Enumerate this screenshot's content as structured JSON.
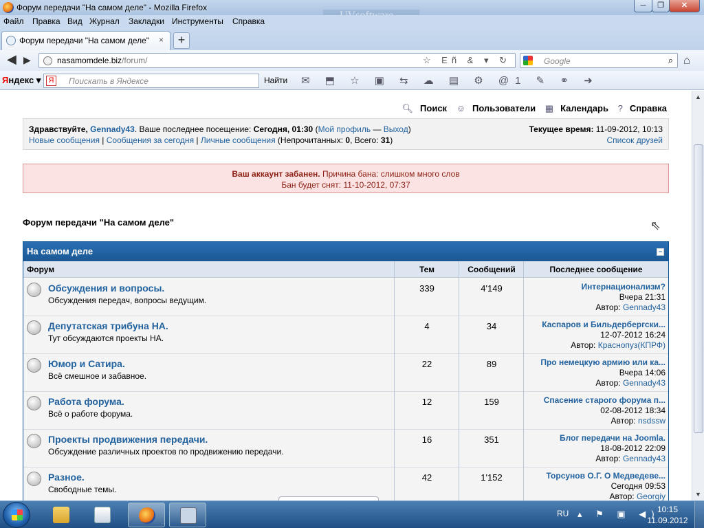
{
  "window": {
    "title": "Форум передачи \"На самом деле\" - Mozilla Firefox",
    "min": "─",
    "max": "❐",
    "close": "✕",
    "bg_text": "UVsoftware"
  },
  "menu": [
    "Файл",
    "Правка",
    "Вид",
    "Журнал",
    "Закладки",
    "Инструменты",
    "Справка"
  ],
  "tab": {
    "label": "Форум передачи \"На самом деле\"",
    "close": "×",
    "new": "+"
  },
  "nav": {
    "back": "◀",
    "forward": "▶",
    "url_host": "nasamomdele.biz",
    "url_path": "/forum/",
    "url_icons": "☆ Eñ & ▾ ↻",
    "search_placeholder": "Google",
    "search_icon": "⌕",
    "home": "⌂"
  },
  "yandex": {
    "logo_first": "Я",
    "logo_rest": "ндекс",
    "logo_arrow": "▾",
    "ya_badge": "Я",
    "placeholder": "Поискать в Яндексе",
    "find": "Найти",
    "toolbar_icons": "✉ ⬒ ☆ ▣ ⇆ ☁ ▤ ⚙ @1 ✎ ⚭ ➜"
  },
  "toplinks": {
    "search": "Поиск",
    "users": "Пользователи",
    "calendar": "Календарь",
    "help": "Справка"
  },
  "welcome": {
    "greeting": "Здравствуйте,",
    "username": "Gennady43",
    "last_visit_label": ". Ваше последнее посещение:",
    "last_visit": "Сегодня, 01:30",
    "profile": "Мой профиль",
    "dash": "—",
    "logout": "Выход",
    "new_posts": "Новые сообщения",
    "today_posts": "Сообщения за сегодня",
    "pm": "Личные сообщения",
    "unread_label": "(Непрочитанных:",
    "unread": "0",
    "total_label": ", Всего:",
    "total": "31",
    "close_paren": ")",
    "time_label": "Текущее время:",
    "time": "11-09-2012, 10:13",
    "friends": "Список друзей",
    "sep": "|"
  },
  "ban": {
    "title": "Ваш аккаунт забанен.",
    "reason": "Причина бана: слишком много слов",
    "until": "Бан будет снят: 11-10-2012, 07:37"
  },
  "forum_title": "Форум передачи \"На самом деле\"",
  "category": {
    "name": "На самом деле",
    "collapse": "−",
    "columns": {
      "forum": "Форум",
      "topics": "Тем",
      "posts": "Сообщений",
      "last": "Последнее сообщение"
    },
    "author_label": "Автор:",
    "rows": [
      {
        "name": "Обсуждения и вопросы.",
        "desc": "Обсуждения передач, вопросы ведущим.",
        "topics": "339",
        "posts": "4'149",
        "last_title": "Интернационализм?",
        "last_date": "Вчера 21:31",
        "last_author": "Gennady43"
      },
      {
        "name": "Депутатская трибуна НА.",
        "desc": "Тут обсуждаются проекты НА.",
        "topics": "4",
        "posts": "34",
        "last_title": "Каспаров и Бильдербергски...",
        "last_date": "12-07-2012 16:24",
        "last_author": "Краснопуз(КПРФ)"
      },
      {
        "name": "Юмор и Сатира.",
        "desc": "Всё смешное и забавное.",
        "topics": "22",
        "posts": "89",
        "last_title": "Про немецкую армию или ка...",
        "last_date": "Вчера 14:06",
        "last_author": "Gennady43"
      },
      {
        "name": "Работа форума.",
        "desc": "Всё о работе форума.",
        "topics": "12",
        "posts": "159",
        "last_title": "Спасение старого форума п...",
        "last_date": "02-08-2012 18:34",
        "last_author": "nsdssw"
      },
      {
        "name": "Проекты продвижения передачи.",
        "desc": "Обсуждение различных проектов по продвижению передачи.",
        "topics": "16",
        "posts": "351",
        "last_title": "Блог передачи на Joomla.",
        "last_date": "18-08-2012 22:09",
        "last_author": "Gennady43"
      },
      {
        "name": "Разное.",
        "desc": "Свободные темы.",
        "topics": "42",
        "posts": "1'152",
        "last_title": "Торсунов О.Г. О Медведеве...",
        "last_date": "Сегодня 09:53",
        "last_author": "Georgiy"
      }
    ]
  },
  "taskbar": {
    "lang": "RU",
    "tray": "▴ ⚑ ▣ ◀)",
    "time": "10:15",
    "date": "11.09.2012"
  }
}
